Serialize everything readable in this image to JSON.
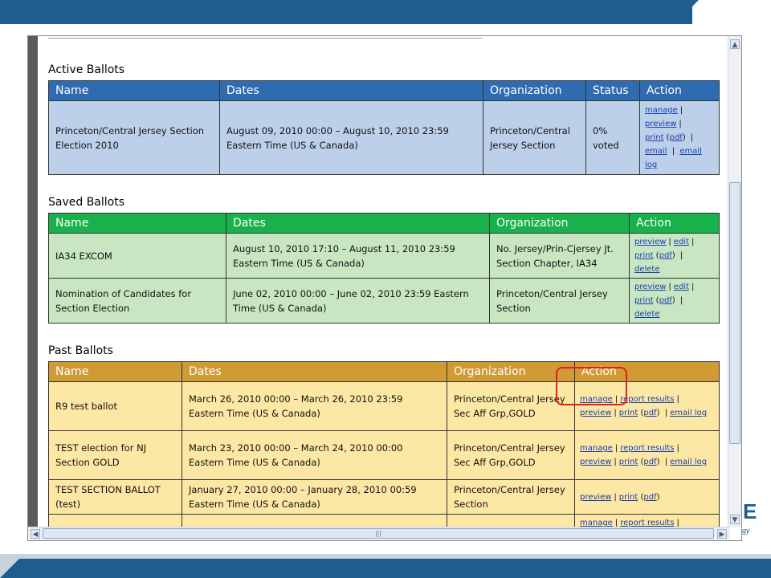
{
  "sections": {
    "active": {
      "title": "Active Ballots",
      "headers": {
        "name": "Name",
        "dates": "Dates",
        "org": "Organization",
        "status": "Status",
        "action": "Action"
      },
      "rows": [
        {
          "name": "Princeton/Central Jersey Section Election 2010",
          "dates": "August 09, 2010 00:00 – August 10, 2010 23:59 Eastern Time (US & Canada)",
          "org": "Princeton/Central Jersey Section",
          "status": "0% voted",
          "links": {
            "manage": "manage",
            "preview": "preview",
            "print": "print",
            "pdf": "pdf",
            "email": "email",
            "email_log": "email log"
          }
        }
      ]
    },
    "saved": {
      "title": "Saved Ballots",
      "headers": {
        "name": "Name",
        "dates": "Dates",
        "org": "Organization",
        "action": "Action"
      },
      "rows": [
        {
          "name": "IA34 EXCOM",
          "dates": "August 10, 2010 17:10 – August 11, 2010 23:59 Eastern Time (US & Canada)",
          "org": "No. Jersey/Prin-Cjersey Jt. Section Chapter, IA34",
          "links": {
            "preview": "preview",
            "edit": "edit",
            "print": "print",
            "pdf": "pdf",
            "delete": "delete"
          }
        },
        {
          "name": "Nomination of Candidates for Section Election",
          "dates": "June 02, 2010 00:00 – June 02, 2010 23:59 Eastern Time (US & Canada)",
          "org": "Princeton/Central Jersey Section",
          "links": {
            "preview": "preview",
            "edit": "edit",
            "print": "print",
            "pdf": "pdf",
            "delete": "delete"
          }
        }
      ]
    },
    "past": {
      "title": "Past Ballots",
      "headers": {
        "name": "Name",
        "dates": "Dates",
        "org": "Organization",
        "action": "Action"
      },
      "rows": [
        {
          "name": "R9 test ballot",
          "dates": "March 26, 2010 00:00 – March 26, 2010 23:59 Eastern Time (US & Canada)",
          "org": "Princeton/Central Jersey Sec Aff Grp,GOLD",
          "links": {
            "manage": "manage",
            "report": "report results",
            "preview": "preview",
            "print": "print",
            "pdf": "pdf",
            "email_log": "email log"
          }
        },
        {
          "name": "TEST election for NJ Section GOLD",
          "dates": "March 23, 2010 00:00 – March 24, 2010 00:00 Eastern Time (US & Canada)",
          "org": "Princeton/Central Jersey Sec Aff Grp,GOLD",
          "links": {
            "manage": "manage",
            "report": "report results",
            "preview": "preview",
            "print": "print",
            "pdf": "pdf",
            "email_log": "email log"
          }
        },
        {
          "name": "TEST SECTION BALLOT (test)",
          "dates": "January 27, 2010 00:00 – January 28, 2010 00:59 Eastern Time (US & Canada)",
          "org": "Princeton/Central Jersey Section",
          "links": {
            "preview": "preview",
            "print": "print",
            "pdf": "pdf"
          }
        },
        {
          "links": {
            "manage": "manage",
            "report": "report results"
          }
        }
      ]
    }
  },
  "logo": {
    "letter": "E",
    "sub": "gy"
  },
  "colors": {
    "active_header": "#2f6bb0",
    "saved_header": "#19b14b",
    "past_header": "#d09a35",
    "highlight": "#e0201b"
  }
}
